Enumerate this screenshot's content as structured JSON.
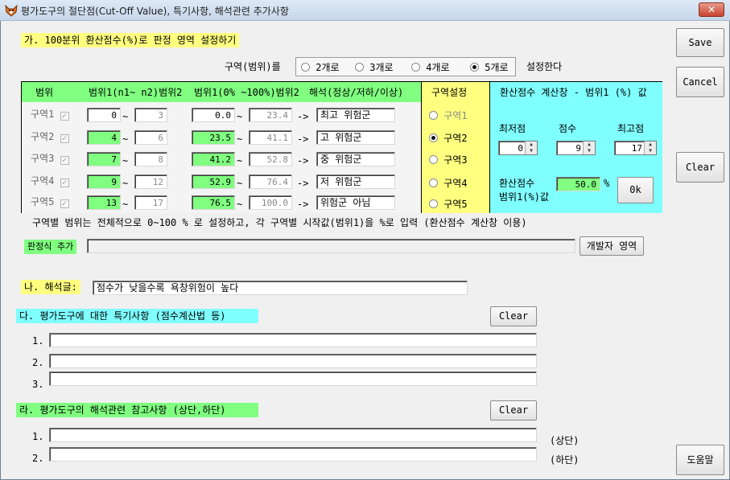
{
  "window": {
    "title": "평가도구의 절단점(Cut-Off Value), 특기사항, 해석관련 추가사항",
    "close_label": "✕"
  },
  "side_buttons": {
    "save": "Save",
    "cancel": "Cancel",
    "clear": "Clear",
    "help": "도움말"
  },
  "section_a": {
    "header": "가. 100분위 환산점수(%)로 판정 영역 설정하기",
    "zone_count_label": "구역(범위)를",
    "zone_count_options": [
      "2개로",
      "3개로",
      "4개로",
      "5개로"
    ],
    "zone_count_selected": 3,
    "zone_count_suffix": "설정한다",
    "columns": {
      "range": "범위",
      "range1": "범위1(n1~ n2)범위2",
      "range2": "범위1(0% ~100%)범위2",
      "interp": "해석(정상/저하/이상)",
      "zone_setting": "구역설정",
      "calc": "환산점수 계산창 - 범위1 (%) 값"
    },
    "tilde": "~",
    "arrow": "->",
    "rows": [
      {
        "zone": "구역1",
        "n1": "0",
        "n2": "3",
        "p1": "0.0",
        "p2": "23.4",
        "interp": "최고 위험군",
        "radio": "구역1"
      },
      {
        "zone": "구역2",
        "n1": "4",
        "n2": "6",
        "p1": "23.5",
        "p2": "41.1",
        "interp": "고 위험군",
        "radio": "구역2"
      },
      {
        "zone": "구역3",
        "n1": "7",
        "n2": "8",
        "p1": "41.2",
        "p2": "52.8",
        "interp": "중 위험군",
        "radio": "구역3"
      },
      {
        "zone": "구역4",
        "n1": "9",
        "n2": "12",
        "p1": "52.9",
        "p2": "76.4",
        "interp": "저 위험군",
        "radio": "구역4"
      },
      {
        "zone": "구역5",
        "n1": "13",
        "n2": "17",
        "p1": "76.5",
        "p2": "100.0",
        "interp": "위험군 아님",
        "radio": "구역5"
      }
    ],
    "zone_radio_selected": 1,
    "calc": {
      "min_label": "최저점",
      "score_label": "점수",
      "max_label": "최고점",
      "min": "0",
      "score": "9",
      "max": "17",
      "result_label_1": "환산점수",
      "result_label_2": "범위1(%)값",
      "result": "50.0",
      "unit": "%",
      "ok": "0k"
    },
    "note": "구역별 범위는 전체적으로 0~100 % 로 설정하고, 각 구역별 시작값(범위1)을 %로 입력 (환산점수 계산창 이용)",
    "formula_label": "판정식 추가",
    "formula_value": "",
    "developer_button": "개발자 영역"
  },
  "section_b": {
    "header": "나. 해석글:",
    "value": "점수가 낮을수록 욕창위험이 높다"
  },
  "section_c": {
    "header": "다. 평가도구에 대한 특기사항 (점수계산법 등)",
    "clear": "Clear",
    "lines": [
      "1.",
      "2.",
      "3."
    ]
  },
  "section_d": {
    "header": "라. 평가도구의 해석관련 참고사항 (상단,하단)",
    "clear": "Clear",
    "lines": [
      "1.",
      "2."
    ],
    "suffixes": [
      "(상단)",
      "(하단)"
    ]
  },
  "colors": {
    "yellow": "#ffff80",
    "cyan": "#80ffff",
    "green": "#80ff80",
    "title_bar": "#c6d6ea"
  }
}
